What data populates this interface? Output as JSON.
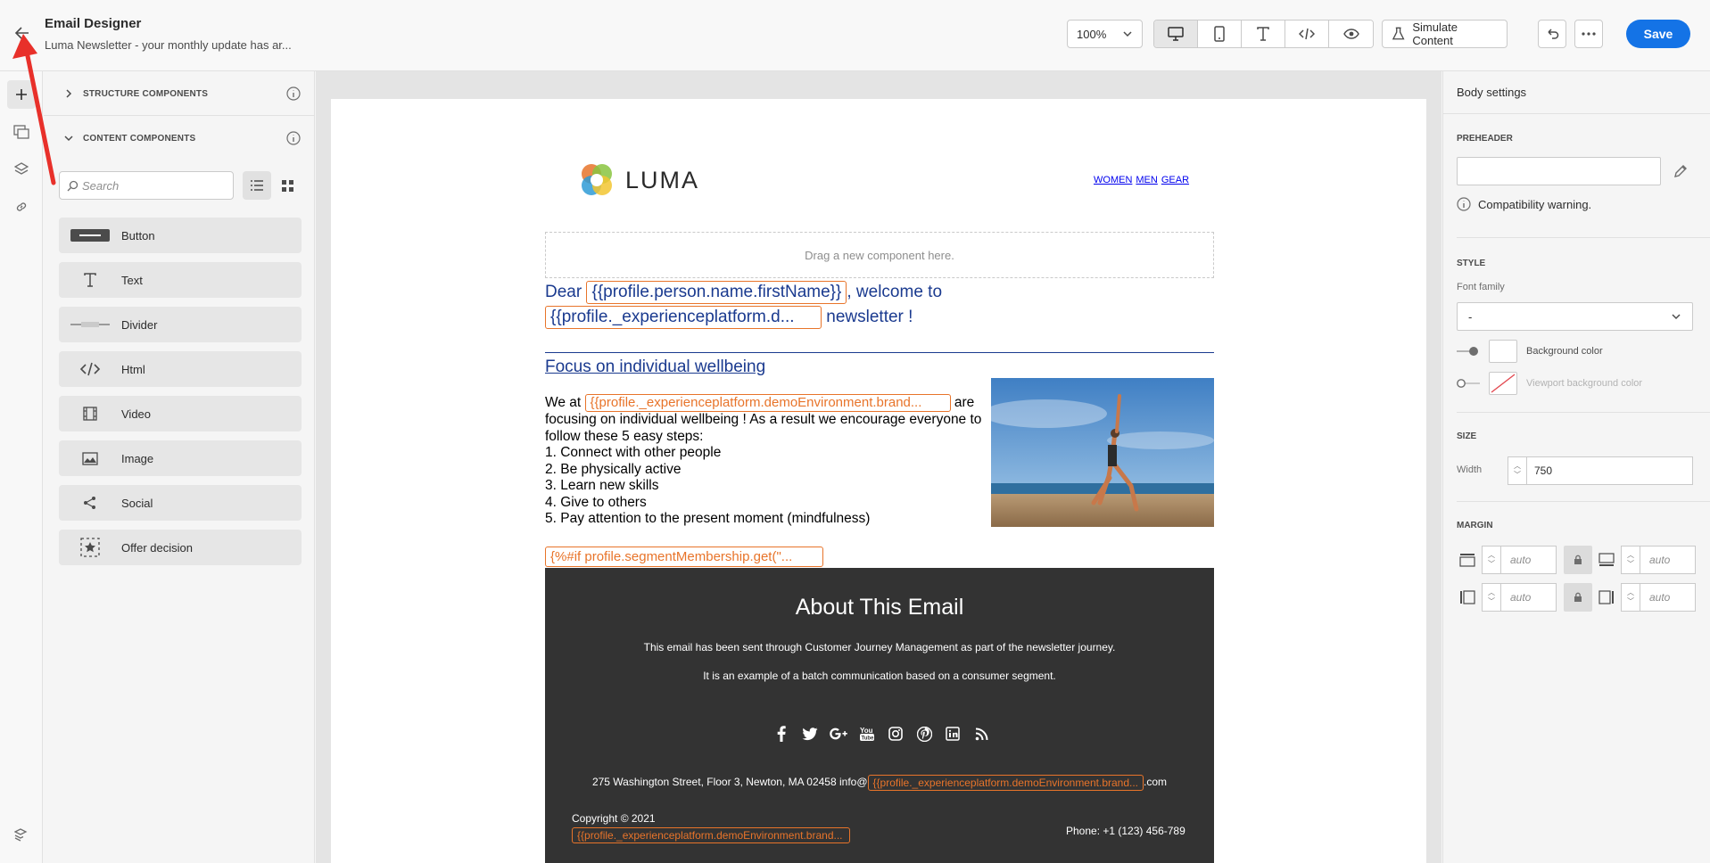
{
  "header": {
    "title": "Email Designer",
    "subtitle": "Luma Newsletter - your monthly update has ar...",
    "zoom": "100%",
    "simulate_label": "Simulate Content",
    "save_label": "Save"
  },
  "components_panel": {
    "structure_label": "STRUCTURE COMPONENTS",
    "content_label": "CONTENT COMPONENTS",
    "search_placeholder": "Search",
    "items": [
      {
        "label": "Button",
        "icon": "button-icon"
      },
      {
        "label": "Text",
        "icon": "text-icon"
      },
      {
        "label": "Divider",
        "icon": "divider-icon"
      },
      {
        "label": "Html",
        "icon": "html-icon"
      },
      {
        "label": "Video",
        "icon": "video-icon"
      },
      {
        "label": "Image",
        "icon": "image-icon"
      },
      {
        "label": "Social",
        "icon": "share-icon"
      },
      {
        "label": "Offer decision",
        "icon": "offer-decision-icon"
      }
    ]
  },
  "email": {
    "logo_text": "LUMA",
    "nav": [
      "WOMEN",
      "MEN",
      "GEAR"
    ],
    "dropzone": "Drag a new component here.",
    "greeting_dear": "Dear",
    "greeting_token1": "{{profile.person.name.firstName}}",
    "greeting_welcome": ", welcome to",
    "greeting_token2": "{{profile._experienceplatform.d...",
    "greeting_newsletter": "newsletter !",
    "focus_title": "Focus on individual wellbeing ",
    "body_we_at": "We at",
    "body_token": "{{profile._experienceplatform.demoEnvironment.brand...",
    "body_are": "are",
    "body_line2": "focusing on individual wellbeing ! As a result we encourage everyone to follow these 5 easy steps:",
    "steps": [
      "1. Connect with other people",
      "2. Be physically active",
      "3. Learn new skills",
      "4. Give to others",
      "5. Pay attention to the present moment (mindfulness)"
    ],
    "condition_token": "{%#if profile.segmentMembership.get(\"...",
    "footer": {
      "title": "About This Email",
      "line1": "This email has been sent through Customer Journey Management as part of the newsletter journey.",
      "line2": "It is an example of a batch communication based on a consumer segment.",
      "address_prefix": "275 Washington Street, Floor 3, Newton, MA 02458 info@",
      "address_token": "{{profile._experienceplatform.demoEnvironment.brand...",
      "address_suffix": ".com",
      "copyright": "Copyright © 2021",
      "copyright_token": "{{profile._experienceplatform.demoEnvironment.brand...",
      "phone": "Phone: +1 (123) 456-789",
      "social_icons": [
        "facebook-icon",
        "twitter-icon",
        "google-plus-icon",
        "youtube-icon",
        "instagram-icon",
        "pinterest-icon",
        "linkedin-icon",
        "rss-icon"
      ]
    }
  },
  "settings": {
    "title": "Body settings",
    "preheader_label": "PREHEADER",
    "compat_warning": "Compatibility warning.",
    "style_label": "STYLE",
    "font_family_label": "Font family",
    "font_family_value": "-",
    "background_color_label": "Background color",
    "viewport_bg_label": "Viewport background color",
    "size_label": "SIZE",
    "width_label": "Width",
    "width_value": "750",
    "margin_label": "MARGIN",
    "margin_placeholder": "auto"
  },
  "colors": {
    "accent": "#1473e6",
    "token_orange": "#e8742a",
    "email_blue": "#1a3a8f",
    "footer_bg": "#333333"
  }
}
